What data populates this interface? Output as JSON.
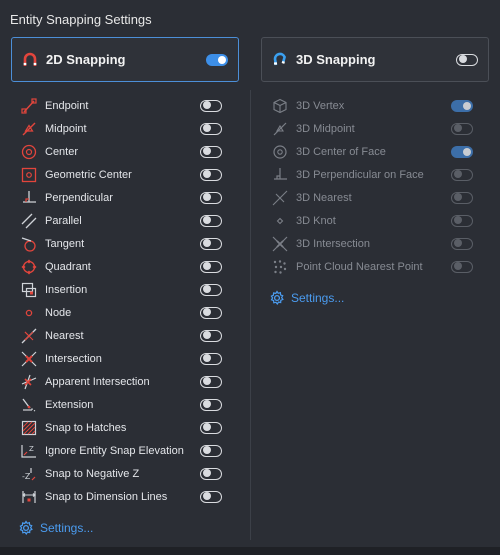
{
  "window": {
    "title": "Entity Snapping Settings"
  },
  "colors": {
    "accent": "#3d8fe8",
    "snap_red": "#e2453c",
    "link": "#4b9cf0",
    "background": "#2b2e35"
  },
  "panel_2d": {
    "title": "2D Snapping",
    "icon": "magnet-icon",
    "enabled": true,
    "items": [
      {
        "label": "Endpoint",
        "icon": "endpoint-icon",
        "on": false
      },
      {
        "label": "Midpoint",
        "icon": "midpoint-icon",
        "on": false
      },
      {
        "label": "Center",
        "icon": "center-icon",
        "on": false
      },
      {
        "label": "Geometric Center",
        "icon": "geometric-center-icon",
        "on": false
      },
      {
        "label": "Perpendicular",
        "icon": "perpendicular-icon",
        "on": false
      },
      {
        "label": "Parallel",
        "icon": "parallel-icon",
        "on": false
      },
      {
        "label": "Tangent",
        "icon": "tangent-icon",
        "on": false
      },
      {
        "label": "Quadrant",
        "icon": "quadrant-icon",
        "on": false
      },
      {
        "label": "Insertion",
        "icon": "insertion-icon",
        "on": false
      },
      {
        "label": "Node",
        "icon": "node-icon",
        "on": false
      },
      {
        "label": "Nearest",
        "icon": "nearest-icon",
        "on": false
      },
      {
        "label": "Intersection",
        "icon": "intersection-icon",
        "on": false
      },
      {
        "label": "Apparent Intersection",
        "icon": "apparent-intersection-icon",
        "on": false
      },
      {
        "label": "Extension",
        "icon": "extension-icon",
        "on": false
      },
      {
        "label": "Snap to Hatches",
        "icon": "hatch-icon",
        "on": false
      },
      {
        "label": "Ignore Entity Snap Elevation",
        "icon": "ignore-elevation-icon",
        "on": false
      },
      {
        "label": "Snap to Negative Z",
        "icon": "negative-z-icon",
        "on": false
      },
      {
        "label": "Snap to Dimension Lines",
        "icon": "dimension-lines-icon",
        "on": false
      }
    ],
    "settings_label": "Settings..."
  },
  "panel_3d": {
    "title": "3D Snapping",
    "icon": "magnet-3d-icon",
    "enabled": false,
    "items": [
      {
        "label": "3D Vertex",
        "icon": "vertex-3d-icon",
        "on": true
      },
      {
        "label": "3D Midpoint",
        "icon": "midpoint-3d-icon",
        "on": false
      },
      {
        "label": "3D Center of Face",
        "icon": "center-of-face-icon",
        "on": true
      },
      {
        "label": "3D Perpendicular on Face",
        "icon": "perpendicular-face-icon",
        "on": false
      },
      {
        "label": "3D Nearest",
        "icon": "nearest-3d-icon",
        "on": false
      },
      {
        "label": "3D Knot",
        "icon": "knot-icon",
        "on": false
      },
      {
        "label": "3D Intersection",
        "icon": "intersection-3d-icon",
        "on": false
      },
      {
        "label": "Point Cloud Nearest Point",
        "icon": "point-cloud-icon",
        "on": false
      }
    ],
    "settings_label": "Settings..."
  }
}
